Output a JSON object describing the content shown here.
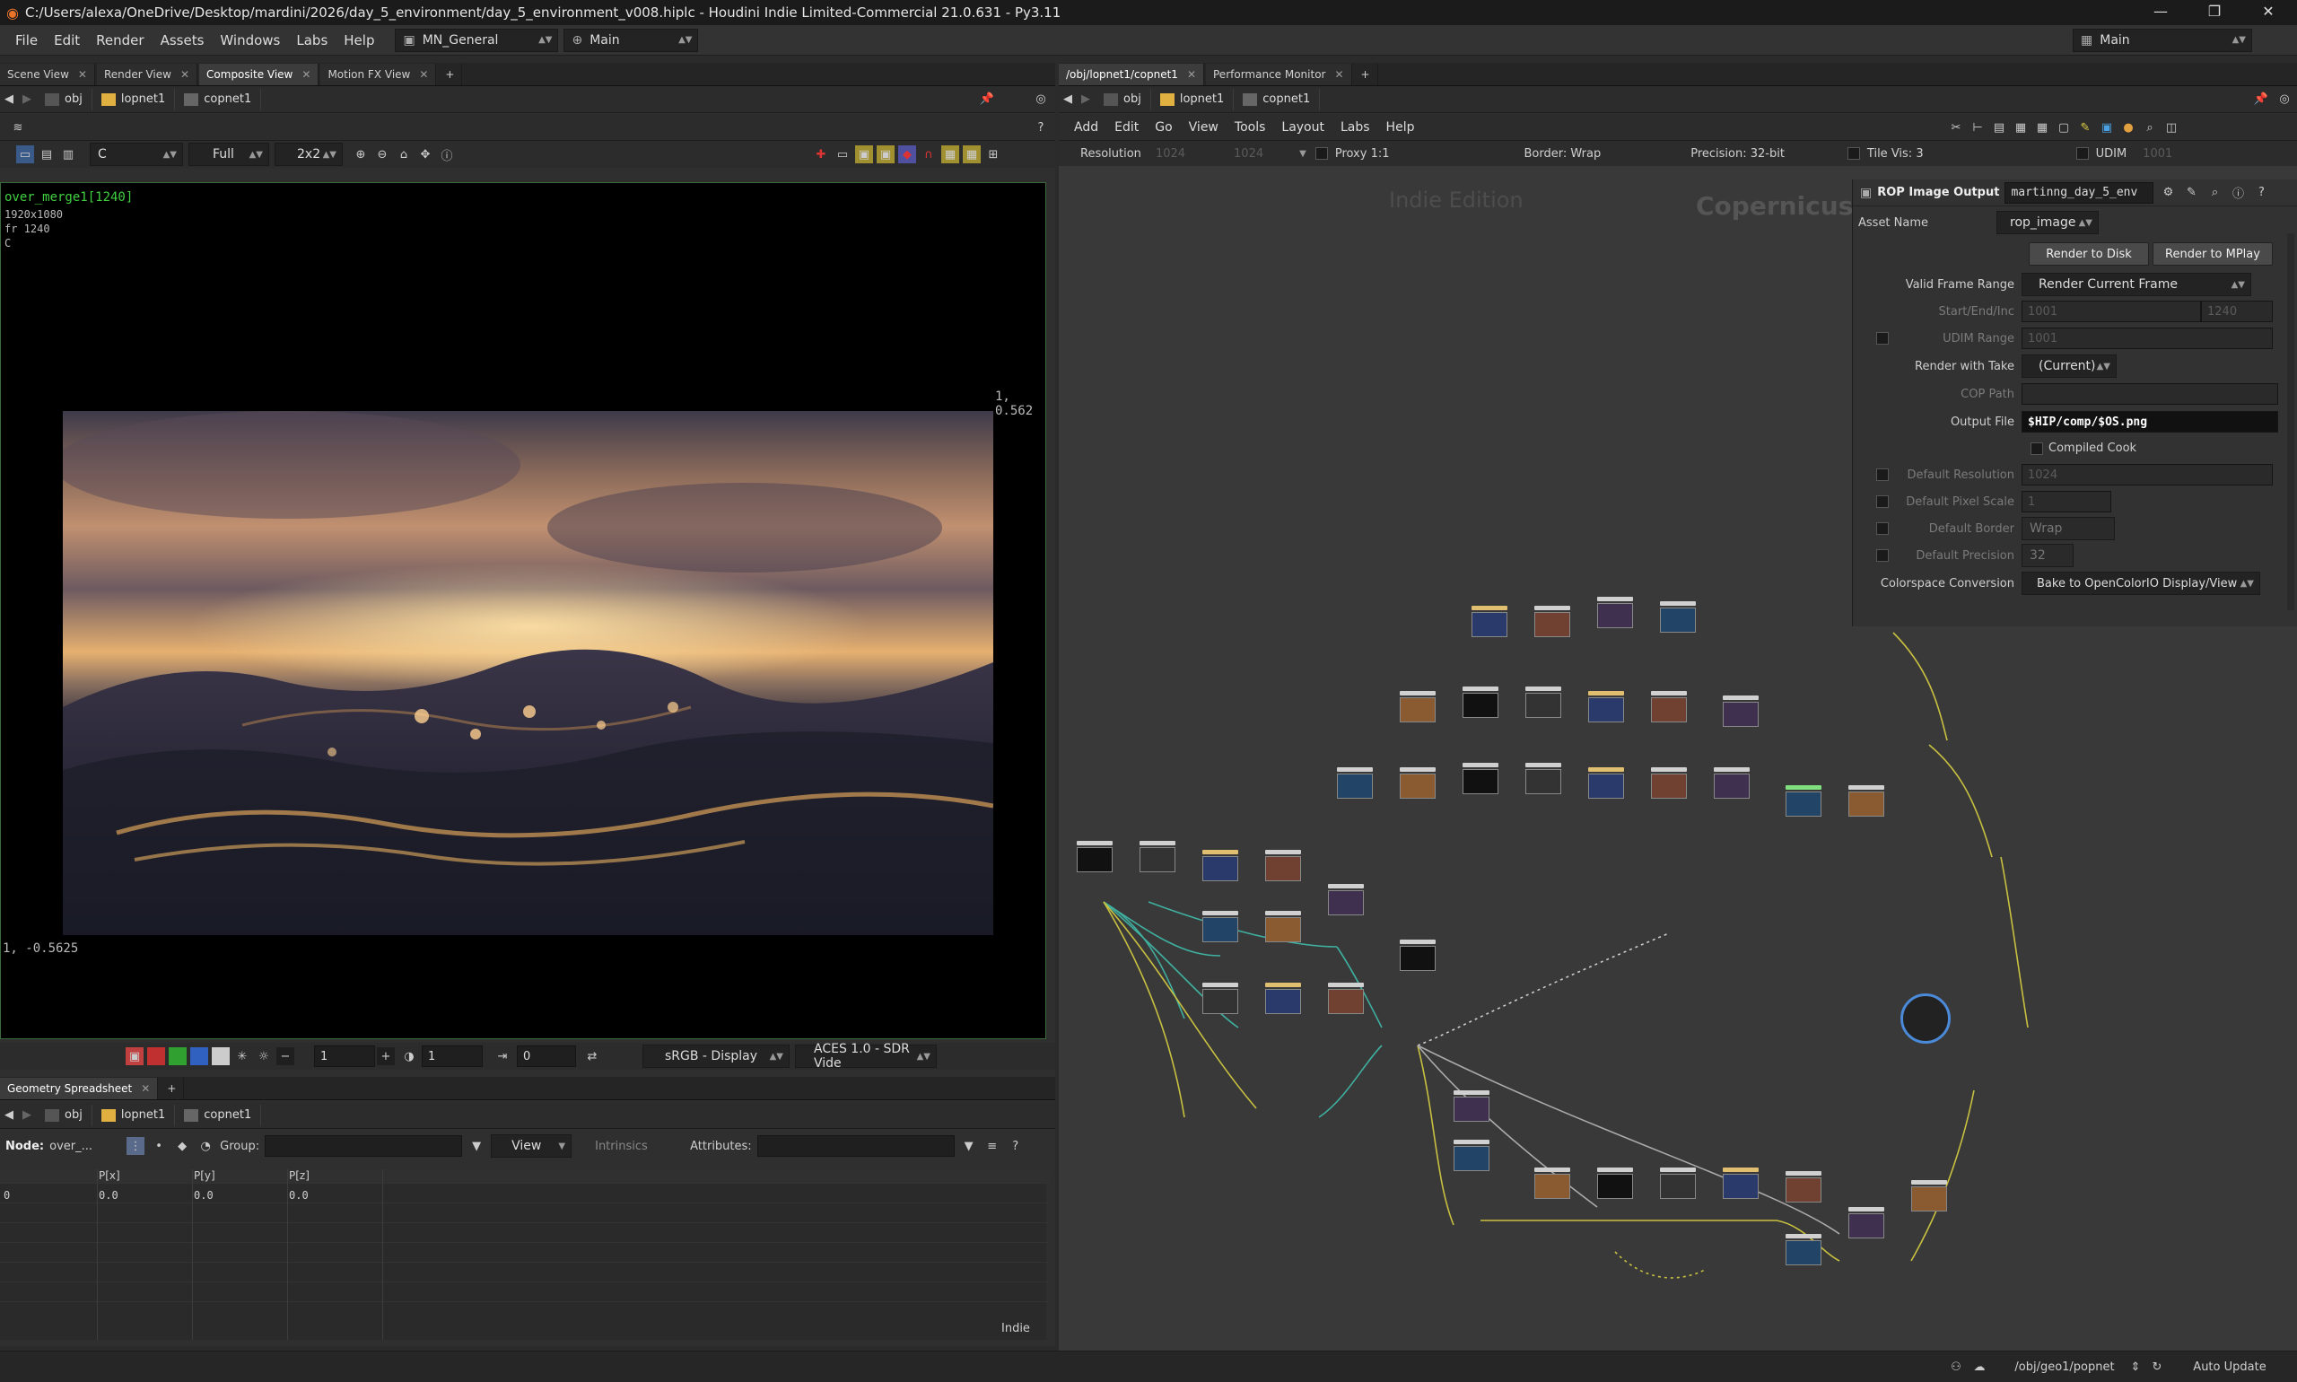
{
  "app": {
    "title": "C:/Users/alexa/OneDrive/Desktop/mardini/2026/day_5_environment/day_5_environment_v008.hiplc - Houdini Indie Limited-Commercial 21.0.631 - Py3.11"
  },
  "menu": {
    "items": [
      "File",
      "Edit",
      "Render",
      "Assets",
      "Windows",
      "Labs",
      "Help"
    ],
    "desktop": "MN_General",
    "context": "Main",
    "right_desktop": "Main"
  },
  "left_pane": {
    "tabs": [
      "Scene View",
      "Render View",
      "Composite View",
      "Motion FX View"
    ],
    "active_tab": "Composite View",
    "path": {
      "root": "obj",
      "lop": "lopnet1",
      "cop": "copnet1"
    },
    "toolbar": {
      "channel": "C",
      "res": "Full",
      "tile": "2x2"
    },
    "viewport": {
      "node": "over_merge1[1240]",
      "size": "1920x1080",
      "frame": "fr 1240",
      "plane": "C",
      "coord_tr": "1, 0.562",
      "coord_bl": "1, -0.5625"
    },
    "bottom": {
      "frame_a": "1",
      "frame_b": "1",
      "offset": "0",
      "display": "sRGB - Display",
      "view": "ACES 1.0 - SDR Vide"
    }
  },
  "spreadsheet": {
    "tab": "Geometry Spreadsheet",
    "path": {
      "root": "obj",
      "lop": "lopnet1",
      "cop": "copnet1"
    },
    "node_label": "Node:",
    "node_value": "over_...",
    "group_label": "Group:",
    "view": "View",
    "intrinsics": "Intrinsics",
    "attributes_label": "Attributes:",
    "columns": [
      "",
      "P[x]",
      "P[y]",
      "P[z]"
    ],
    "rows": [
      [
        "0",
        "0.0",
        "0.0",
        "0.0"
      ]
    ],
    "watermark": "Indie"
  },
  "right_pane": {
    "tabs": [
      "/obj/lopnet1/copnet1",
      "Performance Monitor"
    ],
    "path": {
      "root": "obj",
      "lop": "lopnet1",
      "cop": "copnet1"
    },
    "menu": [
      "Add",
      "Edit",
      "Go",
      "View",
      "Tools",
      "Layout",
      "Labs",
      "Help"
    ],
    "info": {
      "resolution_label": "Resolution",
      "res_x": "1024",
      "res_y": "1024",
      "proxy": "Proxy 1:1",
      "border": "Border: Wrap",
      "precision": "Precision: 32-bit",
      "tile_vis": "Tile Vis: 3",
      "udim": "UDIM",
      "udim_val": "1001"
    },
    "watermark_edition": "Indie Edition",
    "watermark_context": "Copernicus"
  },
  "params": {
    "header_type": "ROP Image Output",
    "header_name": "martinng_day_5_env",
    "asset_name_label": "Asset Name",
    "asset_name": "rop_image",
    "render_disk": "Render to Disk",
    "render_mplay": "Render to MPlay",
    "rows": [
      {
        "label": "Valid Frame Range",
        "value": "Render Current Frame"
      },
      {
        "label": "Start/End/Inc",
        "value": "1001",
        "value2": "1240"
      },
      {
        "label": "UDIM Range",
        "value": "1001"
      },
      {
        "label": "Render with Take",
        "value": "(Current)"
      },
      {
        "label": "COP Path",
        "value": ""
      },
      {
        "label": "Output File",
        "value": "$HIP/comp/$OS.png"
      },
      {
        "label": "Compiled Cook",
        "value": ""
      },
      {
        "label": "Default Resolution",
        "value": "1024"
      },
      {
        "label": "Default Pixel Scale",
        "value": "1"
      },
      {
        "label": "Default Border",
        "value": "Wrap"
      },
      {
        "label": "Default Precision",
        "value": "32"
      },
      {
        "label": "Colorspace Conversion",
        "value": "Bake to OpenColorIO Display/View"
      }
    ]
  },
  "status": {
    "path": "/obj/geo1/popnet",
    "auto_update": "Auto Update"
  },
  "colors": {
    "accent_green": "#3fbf3f",
    "houdini_orange": "#e8732a",
    "viewport_border": "#3a6a3a"
  }
}
